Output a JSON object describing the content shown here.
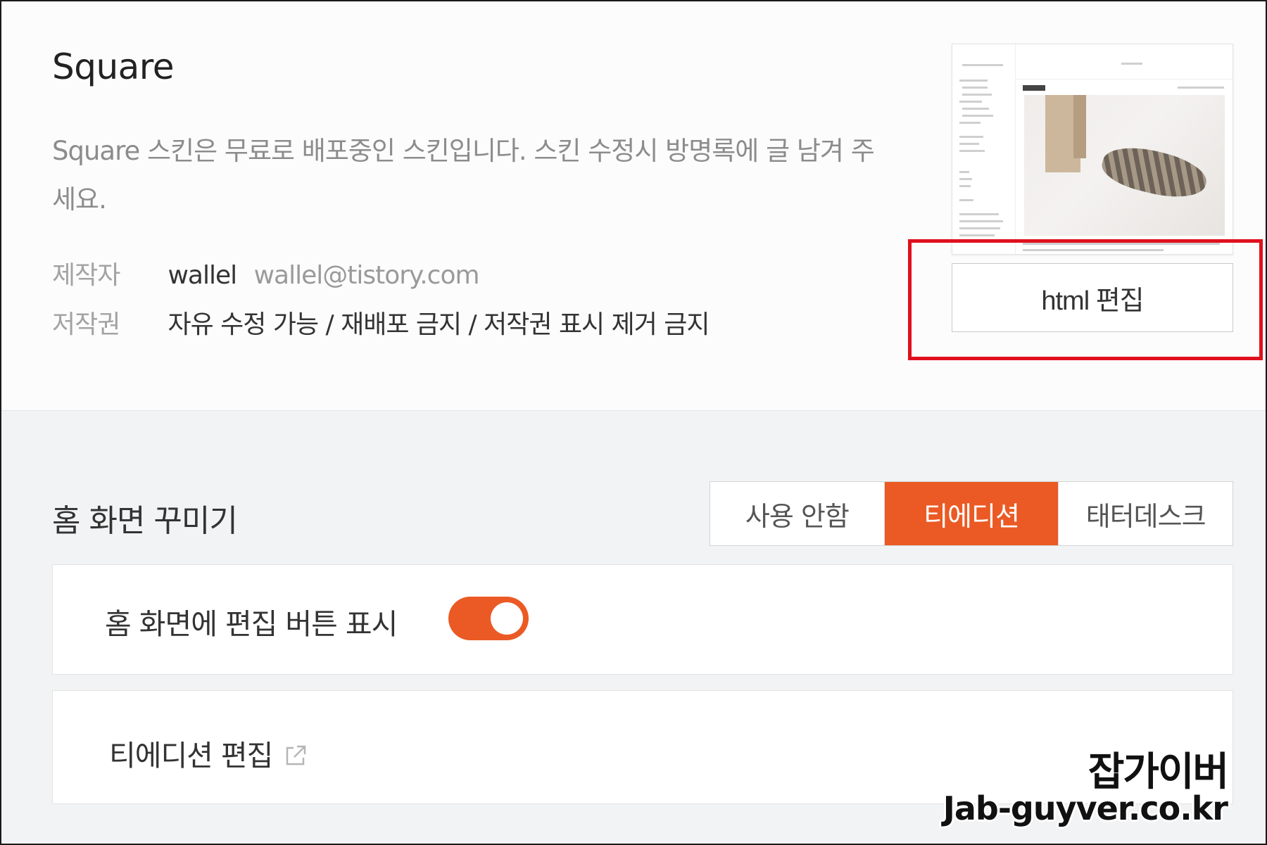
{
  "skin": {
    "title": "Square",
    "description": "Square 스킨은 무료로 배포중인 스킨입니다. 스킨 수정시 방명록에 글 남겨 주세요.",
    "author_label": "제작자",
    "author_name": "wallel",
    "author_email": "wallel@tistory.com",
    "copyright_label": "저작권",
    "copyright_value": "자유 수정 가능 / 재배포 금지 / 저작권 표시 제거 금지",
    "edit_html_label": "html 편집"
  },
  "home": {
    "title": "홈 화면 꾸미기",
    "options": [
      {
        "label": "사용 안함",
        "active": false
      },
      {
        "label": "티에디션",
        "active": true
      },
      {
        "label": "태터데스크",
        "active": false
      }
    ],
    "toggle_label": "홈 화면에 편집 버튼 표시",
    "toggle_on": true,
    "tedition_edit_label": "티에디션 편집"
  },
  "watermark": {
    "line1": "잡가이버",
    "line2": "Jab-guyver.co.kr"
  },
  "colors": {
    "accent": "#eb5a24",
    "highlight": "#e0101e"
  }
}
